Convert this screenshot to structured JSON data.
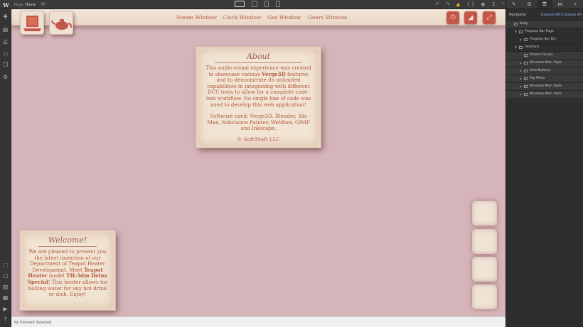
{
  "topbar": {
    "logo": "W",
    "page_prefix": "Page:",
    "page_name": "Home",
    "publish_label": "Publish",
    "icons": [
      "refresh-icon",
      "undo-icon",
      "redo-icon",
      "warning-icon",
      "code-icon",
      "preview-icon",
      "publish-icon"
    ]
  },
  "left_toolbar": {
    "icons": [
      "add-icon",
      "pages-icon",
      "cms-icon",
      "ecommerce-icon",
      "assets-icon",
      "settings-icon",
      "select-icon",
      "box-select-icon",
      "audit-icon",
      "navigator-icon",
      "video-icon",
      "help-icon"
    ]
  },
  "site": {
    "menu": [
      "Steam Window",
      "Clock Window",
      "Gas Window",
      "Gears Window"
    ],
    "about": {
      "title": "About",
      "intro_a": "This audio-visual experience was created to showcase various",
      "brand": "Verge3D",
      "intro_b": "features and to demonstrate its unlimited capabilities in integrating with different DCC tools to allow for a complete code-less workflow. No single line of code was used to develop this web application!",
      "software": "Software used: Verge3D, Blender, 3ds Max, Substance Painter, Webflow, GIMP and Inkscape.",
      "copyright": "© Soft8Soft LLC"
    },
    "welcome": {
      "title": "Welcome!",
      "text_a": "We are pleased to present you the latest invention of our Department of Teapot Heater Development. Meet",
      "product": "Teapot Heater",
      "text_b": "model",
      "model": "TH-3dm Delux Special",
      "text_c": "! This heater allows for boiling water for any hot drink or dish. Enjoy!"
    }
  },
  "statusbar": {
    "text": "No Element Selected"
  },
  "right_panel": {
    "tabs": [
      "brush-icon",
      "gear-icon",
      "navigator-icon",
      "interactions-icon",
      "lightning-icon"
    ],
    "title": "Navigator",
    "expand_all": "Expand All",
    "collapse_all": "Collapse All",
    "tree": [
      {
        "label": "Body",
        "depth": 0,
        "arrow": "",
        "dark": true
      },
      {
        "label": "Progress Bar Page",
        "depth": 1,
        "arrow": "▼",
        "dark": false
      },
      {
        "label": "Progress Bar Div",
        "depth": 2,
        "arrow": "▶",
        "dark": false
      },
      {
        "label": "Interface",
        "depth": 1,
        "arrow": "▼",
        "dark": false
      },
      {
        "label": "Iframe Canvas",
        "depth": 2,
        "arrow": "",
        "dark": true
      },
      {
        "label": "Windows Main Style",
        "depth": 2,
        "arrow": "▶",
        "dark": true
      },
      {
        "label": "Item Buttons",
        "depth": 2,
        "arrow": "▶",
        "dark": true
      },
      {
        "label": "Top Menu",
        "depth": 2,
        "arrow": "▶",
        "dark": true
      },
      {
        "label": "Windows Main Style",
        "depth": 2,
        "arrow": "▶",
        "dark": true
      },
      {
        "label": "Windows Main Style",
        "depth": 2,
        "arrow": "▶",
        "dark": true
      }
    ]
  },
  "colors": {
    "canvas_bg": "#d6b5ba",
    "accent": "#c4574a",
    "text_terracotta": "#b3573f",
    "card_bg": "#f1e4d2"
  }
}
